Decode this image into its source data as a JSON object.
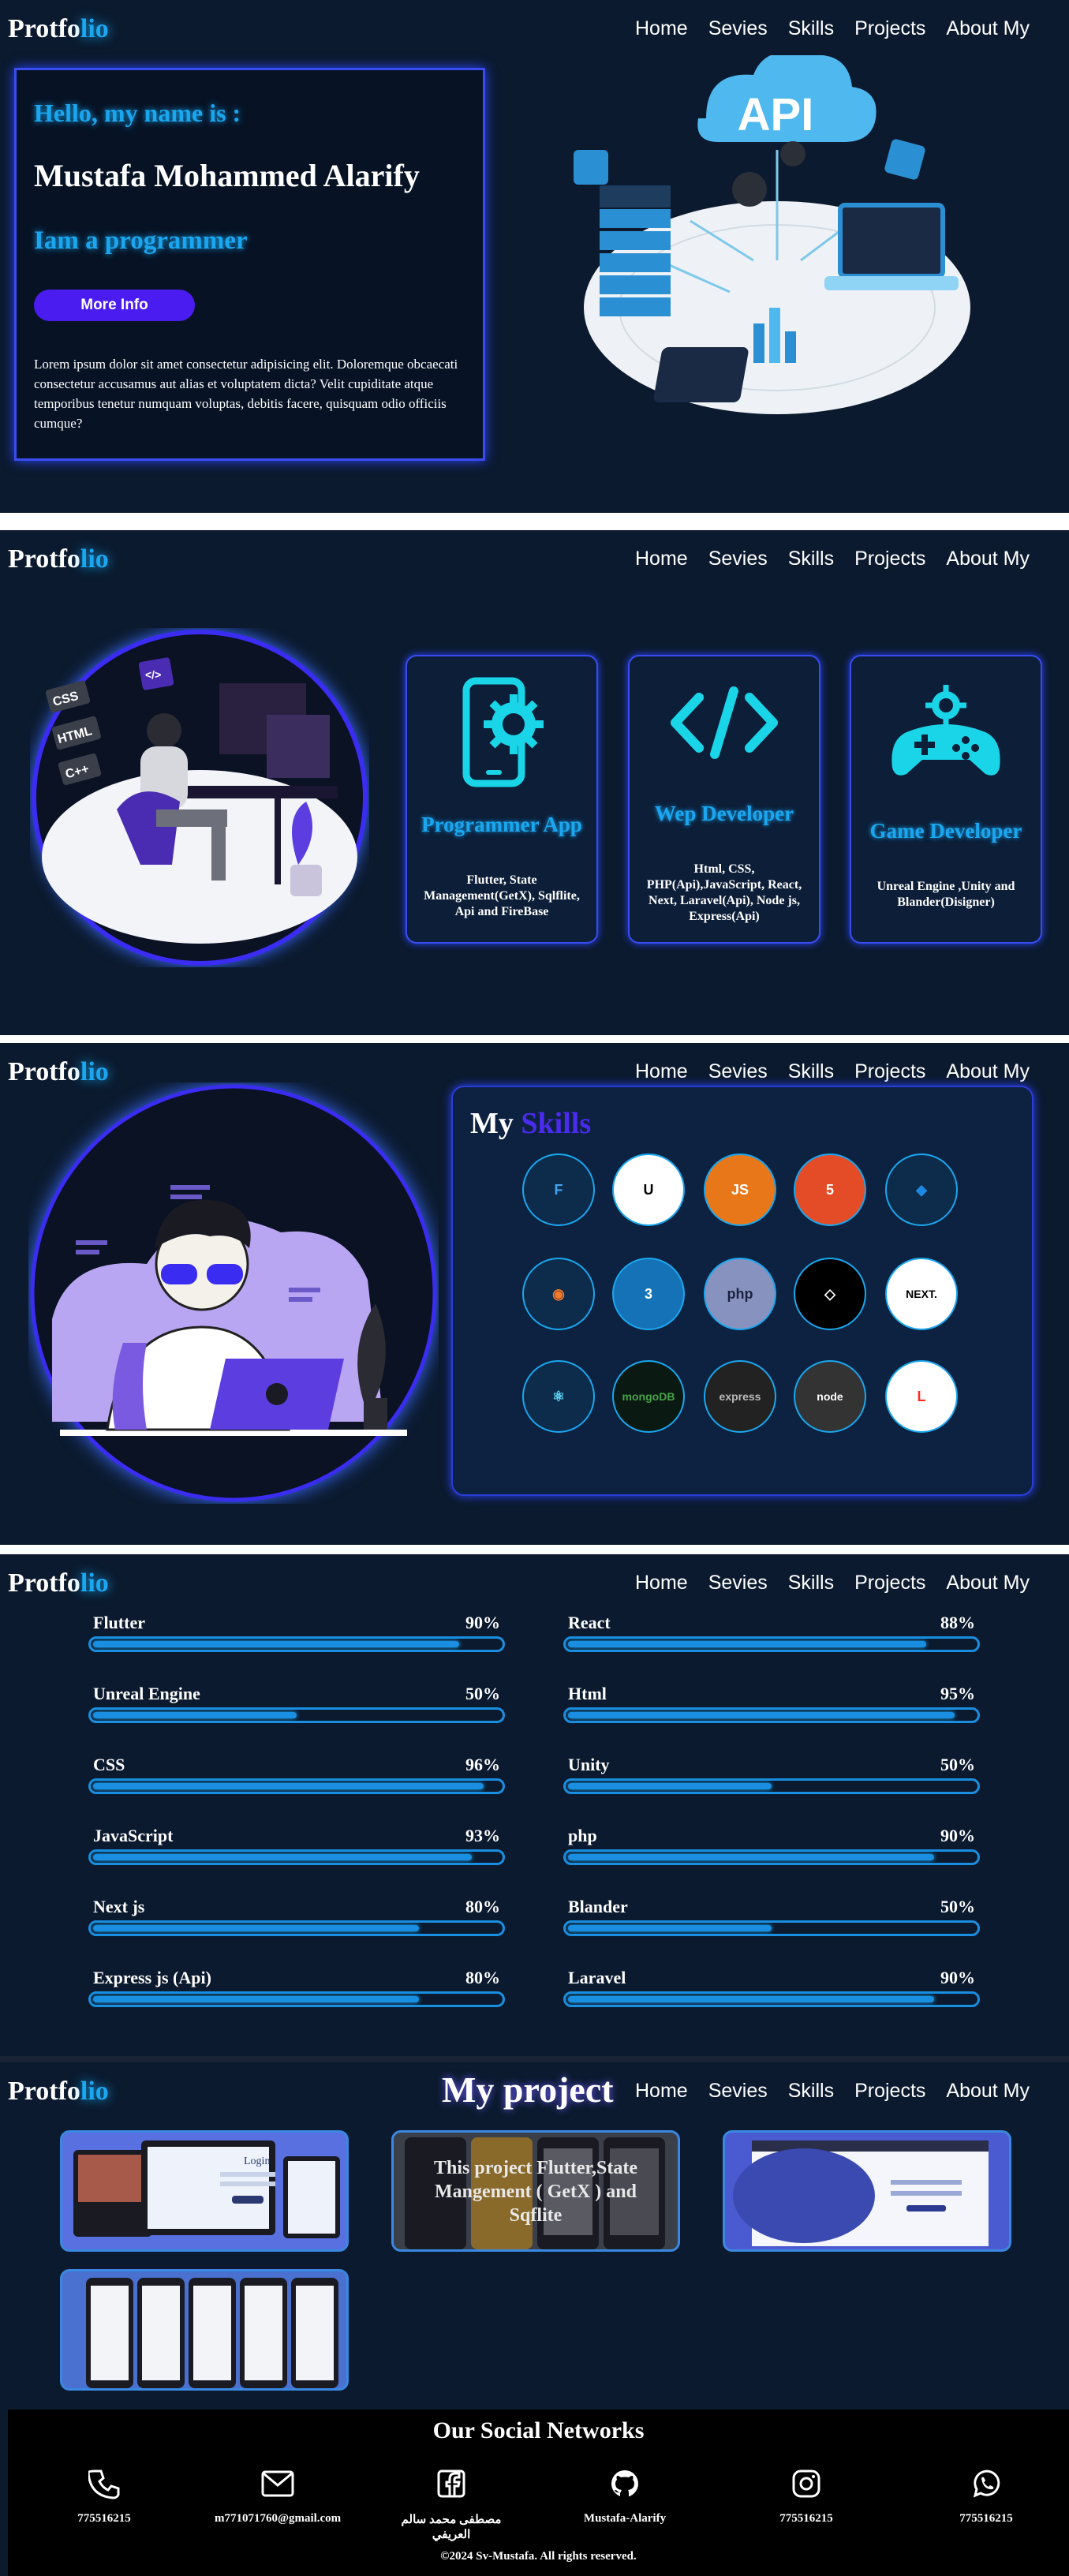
{
  "header": {
    "logo_a": "Protfo",
    "logo_b": "lio",
    "nav": [
      "Home",
      "Sevies",
      "Skills",
      "Projects",
      "About My"
    ]
  },
  "hero": {
    "hello": "Hello, my name is :",
    "name": "Mustafa Mohammed Alarify",
    "role": "Iam a programmer",
    "button": "More Info",
    "text": "Lorem ipsum dolor sit amet consectetur adipisicing elit. Doloremque obcaecati consectetur accusamus aut alias et voluptatem dicta? Velit cupiditate atque temporibus tenetur numquam voluptas, debitis facere, quisquam odio officiis cumque?",
    "illustration_label": "API"
  },
  "services": [
    {
      "title": "Programmer App",
      "desc": "Flutter, State Management(GetX), Sqlflite, Api and FireBase",
      "icon": "phone-gear-icon"
    },
    {
      "title": "Wep Developer",
      "desc": "Html, CSS, PHP(Api),JavaScript, React, Next, Laravel(Api), Node js, Express(Api)",
      "icon": "code-icon"
    },
    {
      "title": "Game Developer",
      "desc": "Unreal Engine ,Unity and Blander(Disigner)",
      "icon": "gamepad-gear-icon"
    }
  ],
  "services_art": {
    "tags": [
      "CSS",
      "HTML",
      "C++"
    ],
    "code_tag": "</>"
  },
  "skills": {
    "title_a": "My",
    "title_b": "Skills",
    "badges": [
      {
        "label": "F",
        "icon": "flutter-icon",
        "bg": "#0d2b4a",
        "fg": "#42a5f5"
      },
      {
        "label": "U",
        "icon": "unreal-icon",
        "bg": "#ffffff",
        "fg": "#000000"
      },
      {
        "label": "JS",
        "icon": "javascript-icon",
        "bg": "#e8771a",
        "fg": "#ffffff"
      },
      {
        "label": "5",
        "icon": "html5-icon",
        "bg": "#e34c26",
        "fg": "#ffffff"
      },
      {
        "label": "◆",
        "icon": "dart-icon",
        "bg": "#0d2b4a",
        "fg": "#1e88e5"
      },
      {
        "label": "◉",
        "icon": "blender-icon",
        "bg": "#0d2b4a",
        "fg": "#f5792a"
      },
      {
        "label": "3",
        "icon": "css3-icon",
        "bg": "#1572b6",
        "fg": "#ffffff"
      },
      {
        "label": "php",
        "icon": "php-icon",
        "bg": "#8892bf",
        "fg": "#1a2240"
      },
      {
        "label": "◇",
        "icon": "unity-icon",
        "bg": "#000000",
        "fg": "#ffffff"
      },
      {
        "label": "NEXT.",
        "icon": "nextjs-icon",
        "bg": "#ffffff",
        "fg": "#000000"
      },
      {
        "label": "⚛",
        "icon": "react-icon",
        "bg": "#0d2b4a",
        "fg": "#61dafb"
      },
      {
        "label": "mongoDB",
        "icon": "mongodb-icon",
        "bg": "#0a1a12",
        "fg": "#47a248"
      },
      {
        "label": "express",
        "icon": "express-icon",
        "bg": "#222222",
        "fg": "#bbbbbb"
      },
      {
        "label": "node",
        "icon": "nodejs-icon",
        "bg": "#333333",
        "fg": "#ffffff"
      },
      {
        "label": "L",
        "icon": "laravel-icon",
        "bg": "#ffffff",
        "fg": "#ff2d20"
      }
    ]
  },
  "progress": [
    {
      "label": "Flutter",
      "pct": "90%",
      "value": 0.9
    },
    {
      "label": "React",
      "pct": "88%",
      "value": 0.88
    },
    {
      "label": "Unreal Engine",
      "pct": "50%",
      "value": 0.5
    },
    {
      "label": "Html",
      "pct": "95%",
      "value": 0.95
    },
    {
      "label": "CSS",
      "pct": "96%",
      "value": 0.96
    },
    {
      "label": "Unity",
      "pct": "50%",
      "value": 0.5
    },
    {
      "label": "JavaScript",
      "pct": "93%",
      "value": 0.93
    },
    {
      "label": "php",
      "pct": "90%",
      "value": 0.9
    },
    {
      "label": "Next js",
      "pct": "80%",
      "value": 0.8
    },
    {
      "label": "Blander",
      "pct": "50%",
      "value": 0.5
    },
    {
      "label": "Express js (Api)",
      "pct": "80%",
      "value": 0.8
    },
    {
      "label": "Laravel",
      "pct": "90%",
      "value": 0.9
    }
  ],
  "projects": {
    "title": "My project",
    "overlay": "This project Flutter,State Mangement ( GetX ) and Sqflite",
    "login_label": "Login"
  },
  "footer": {
    "title": "Our Social Networks",
    "items": [
      {
        "label": "775516215",
        "icon": "phone-icon"
      },
      {
        "label": "m771071760@gmail.com",
        "icon": "mail-icon"
      },
      {
        "label": "مصطفى محمد سالم العريفي",
        "icon": "facebook-icon"
      },
      {
        "label": "Mustafa-Alarify",
        "icon": "github-icon"
      },
      {
        "label": "775516215",
        "icon": "instagram-icon"
      },
      {
        "label": "775516215",
        "icon": "whatsapp-icon"
      }
    ],
    "copyright": "©2024 Sv-Mustafa. All rights reserved."
  }
}
